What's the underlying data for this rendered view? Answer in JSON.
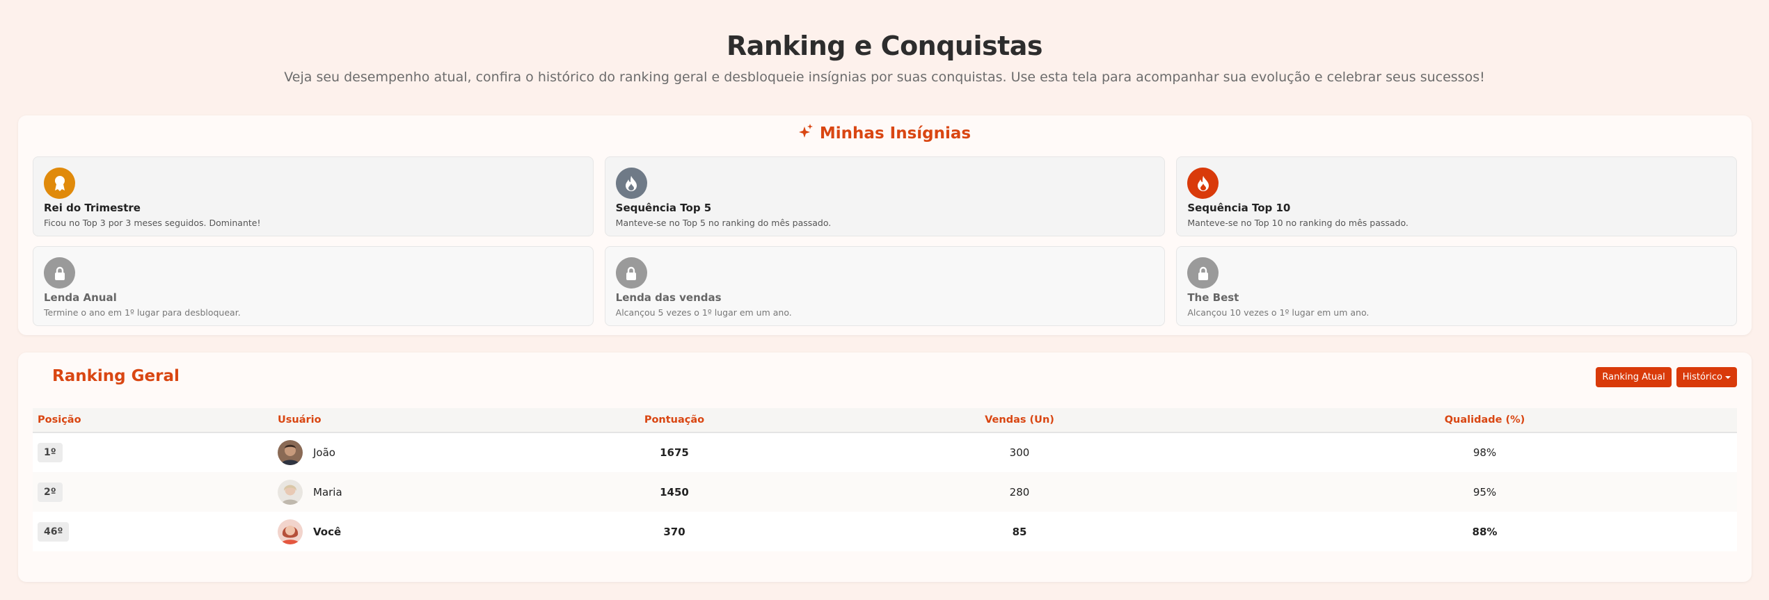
{
  "header": {
    "title": "Ranking e Conquistas",
    "subtitle": "Veja seu desempenho atual, confira o histórico do ranking geral e desbloqueie insígnias por suas conquistas. Use esta tela para acompanhar sua evolução e celebrar seus sucessos!"
  },
  "badges": {
    "title": "Minhas Insígnias",
    "title_icon": "sparkles-icon",
    "accent": "#d94612",
    "items": [
      {
        "name": "Rei do Trimestre",
        "desc": "Ficou no Top 3 por 3 meses seguidos. Dominante!",
        "icon": "award-icon",
        "color": "#e08a0b",
        "locked": false
      },
      {
        "name": "Sequência Top 5",
        "desc": "Manteve-se no Top 5 no ranking do mês passado.",
        "icon": "flame-icon",
        "color": "#6f7a87",
        "locked": false
      },
      {
        "name": "Sequência Top 10",
        "desc": "Manteve-se no Top 10 no ranking do mês passado.",
        "icon": "flame-icon",
        "color": "#d93a0a",
        "locked": false
      },
      {
        "name": "Lenda Anual",
        "desc": "Termine o ano em 1º lugar para desbloquear.",
        "icon": "lock-icon",
        "color": "#9a9a9a",
        "locked": true
      },
      {
        "name": "Lenda das vendas",
        "desc": "Alcançou 5 vezes o 1º lugar em um ano.",
        "icon": "lock-icon",
        "color": "#9a9a9a",
        "locked": true
      },
      {
        "name": "The Best",
        "desc": "Alcançou 10 vezes o 1º lugar em um ano.",
        "icon": "lock-icon",
        "color": "#9a9a9a",
        "locked": true
      }
    ]
  },
  "ranking": {
    "title": "Ranking Geral",
    "current_button": "Ranking Atual",
    "history_button": "Histórico",
    "columns": [
      "Posição",
      "Usuário",
      "Pontuação",
      "Vendas (Un)",
      "Qualidade (%)"
    ],
    "rows": [
      {
        "position": "1º",
        "user": "João",
        "score": "1675",
        "sales": "300",
        "quality": "98%",
        "highlight": false
      },
      {
        "position": "2º",
        "user": "Maria",
        "score": "1450",
        "sales": "280",
        "quality": "95%",
        "highlight": false
      },
      {
        "position": "46º",
        "user": "Você",
        "score": "370",
        "sales": "85",
        "quality": "88%",
        "highlight": true
      }
    ]
  }
}
